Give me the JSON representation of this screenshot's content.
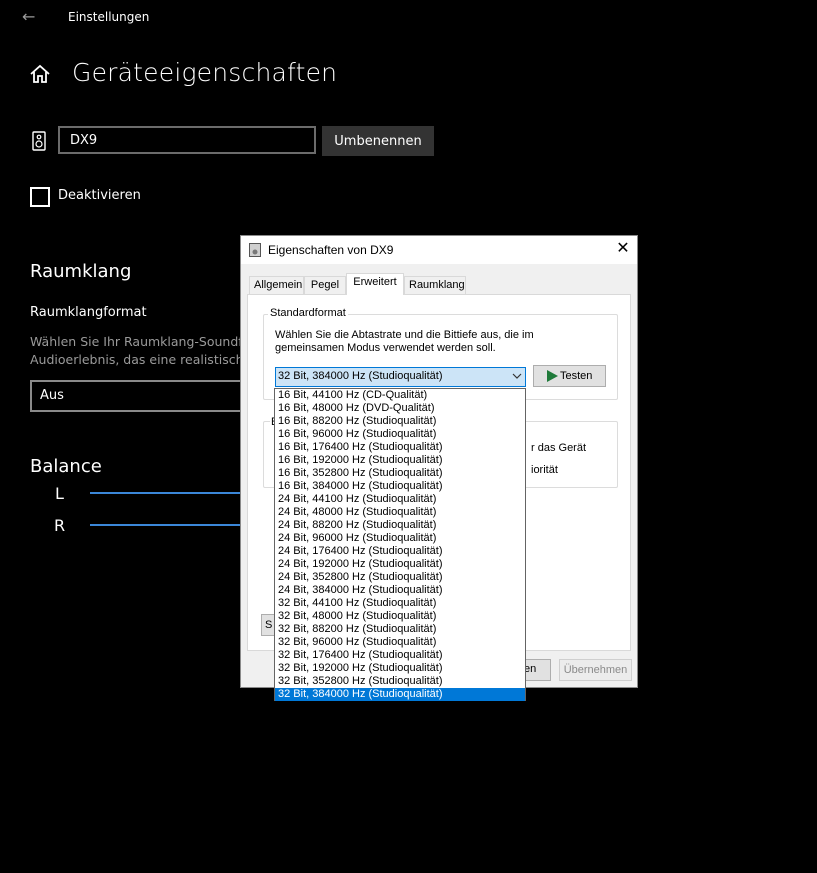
{
  "app": {
    "title": "Einstellungen"
  },
  "page": {
    "title": "Geräteeigenschaften"
  },
  "device": {
    "name_value": "DX9",
    "rename_label": "Umbenennen",
    "disable_label": "Deaktivieren"
  },
  "spatial": {
    "heading": "Raumklang",
    "format_label": "Raumklangformat",
    "desc_line1": "Wählen Sie Ihr Raumklang-Soundf",
    "desc_line2": "Audioerlebnis, das eine realistische",
    "selected": "Aus"
  },
  "balance": {
    "heading": "Balance",
    "left_label": "L",
    "right_label": "R",
    "left_level": 1.0,
    "right_level": 1.0
  },
  "dialog": {
    "title": "Eigenschaften von DX9",
    "tabs": [
      {
        "label": "Allgemein"
      },
      {
        "label": "Pegel"
      },
      {
        "label": "Erweitert"
      },
      {
        "label": "Raumklang"
      }
    ],
    "active_tab": "Erweitert",
    "standard_format": {
      "title": "Standardformat",
      "desc_line1": "Wählen Sie die Abtastrate und die Bittiefe aus, die im",
      "desc_line2": "gemeinsamen Modus verwendet werden soll.",
      "selected": "32 Bit, 384000 Hz (Studioqualität)",
      "test_label": "Testen"
    },
    "exclusive": {
      "title": "E",
      "text1": "r das Gerät",
      "text2": "iorität"
    },
    "defaults_label": "S",
    "cancel_label": "en",
    "apply_label": "Übernehmen"
  },
  "format_options": [
    "16 Bit, 44100 Hz (CD-Qualität)",
    "16 Bit, 48000 Hz (DVD-Qualität)",
    "16 Bit, 88200 Hz (Studioqualität)",
    "16 Bit, 96000 Hz (Studioqualität)",
    "16 Bit, 176400 Hz (Studioqualität)",
    "16 Bit, 192000 Hz (Studioqualität)",
    "16 Bit, 352800 Hz (Studioqualität)",
    "16 Bit, 384000 Hz (Studioqualität)",
    "24 Bit, 44100 Hz (Studioqualität)",
    "24 Bit, 48000 Hz (Studioqualität)",
    "24 Bit, 88200 Hz (Studioqualität)",
    "24 Bit, 96000 Hz (Studioqualität)",
    "24 Bit, 176400 Hz (Studioqualität)",
    "24 Bit, 192000 Hz (Studioqualität)",
    "24 Bit, 352800 Hz (Studioqualität)",
    "24 Bit, 384000 Hz (Studioqualität)",
    "32 Bit, 44100 Hz (Studioqualität)",
    "32 Bit, 48000 Hz (Studioqualität)",
    "32 Bit, 88200 Hz (Studioqualität)",
    "32 Bit, 96000 Hz (Studioqualität)",
    "32 Bit, 176400 Hz (Studioqualität)",
    "32 Bit, 192000 Hz (Studioqualität)",
    "32 Bit, 352800 Hz (Studioqualität)",
    "32 Bit, 384000 Hz (Studioqualität)"
  ],
  "format_selected_index": 23,
  "colors": {
    "accent": "#0078d7",
    "slider": "#3b87d8",
    "background": "#000000"
  }
}
